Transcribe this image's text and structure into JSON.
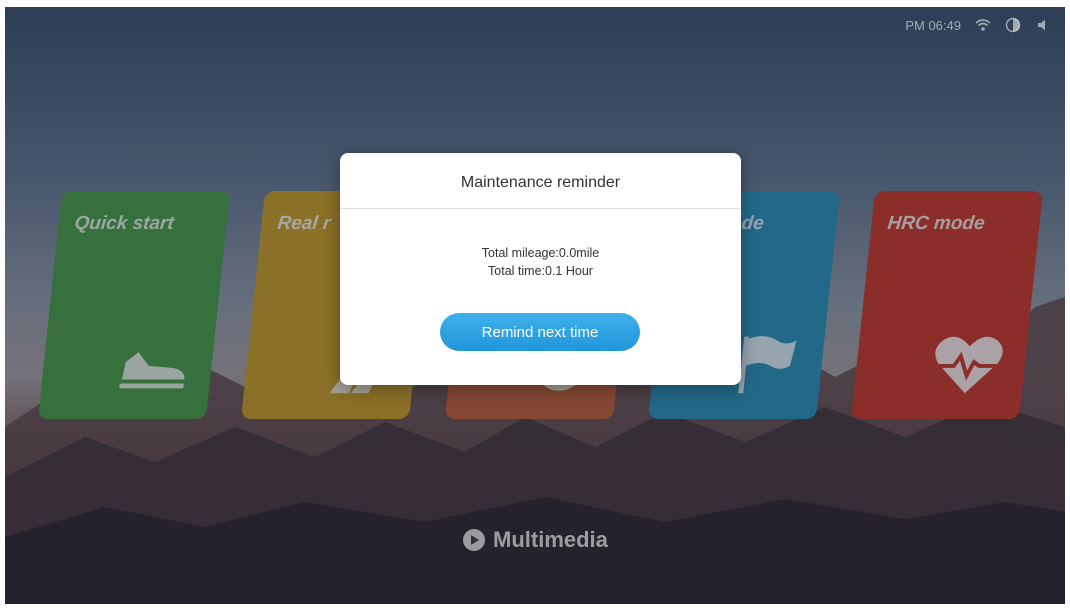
{
  "status_bar": {
    "time": "PM 06:49",
    "icons": [
      "wifi-icon",
      "brightness-icon",
      "volume-icon"
    ]
  },
  "mode_cards": [
    {
      "label": "Quick start",
      "icon": "sneaker-icon",
      "color": "#3e9a3e"
    },
    {
      "label": "Real r",
      "icon": "runner-icon",
      "color": "#c99a1c"
    },
    {
      "label": "",
      "icon": "ring-icon",
      "color": "#c25a2e"
    },
    {
      "label": "ng mode",
      "icon": "flag-icon",
      "color": "#1f8fb8"
    },
    {
      "label": "HRC mode",
      "icon": "heart-rate-icon",
      "color": "#c8301f"
    }
  ],
  "dialog": {
    "title": "Maintenance reminder",
    "mileage": "Total mileage:0.0mile",
    "time": "Total time:0.1 Hour",
    "button_label": "Remind next time",
    "button_color": "#2a9fe0"
  },
  "footer": {
    "brand": "Multimedia",
    "icon": "multimedia-icon"
  }
}
